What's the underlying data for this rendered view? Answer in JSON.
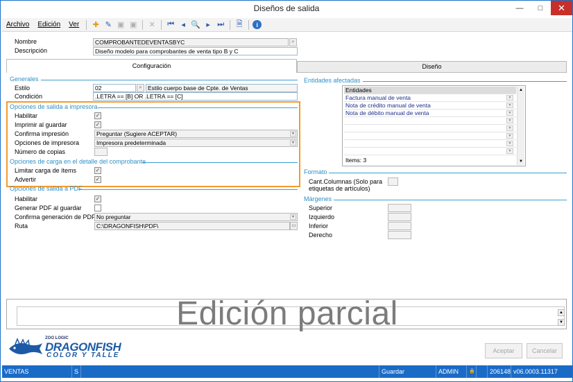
{
  "window": {
    "title": "Diseños de salida"
  },
  "menu": {
    "archivo": "Archivo",
    "edicion": "Edición",
    "ver": "Ver"
  },
  "header": {
    "nombre_label": "Nombre",
    "nombre_value": "COMPROBANTEDEVENTASBYC",
    "descripcion_label": "Descripción",
    "descripcion_value": "Diseño modelo para comprobantes de venta tipo B y C"
  },
  "tabs": {
    "configuracion": "Configuración",
    "diseno": "Diseño"
  },
  "generales": {
    "title": "Generales",
    "estilo_label": "Estilo",
    "estilo_code": "02",
    "estilo_desc": "Estilo cuerpo base de Cpte. de Ventas",
    "condicion_label": "Condición",
    "condicion_value": ".LETRA == [B] OR .LETRA == [C]"
  },
  "impresora": {
    "title": "Opciones de salida a impresora",
    "habilitar_label": "Habilitar",
    "habilitar_checked": true,
    "imprimir_label": "Imprimir al guardar",
    "imprimir_checked": true,
    "confirma_label": "Confirma impresión",
    "confirma_value": "Preguntar (Sugiere ACEPTAR)",
    "opciones_label": "Opciones de impresora",
    "opciones_value": "Impresora predeterminada",
    "copias_label": "Número de copias",
    "copias_value": ""
  },
  "carga": {
    "title": "Opciones de carga en el detalle del comprobante",
    "limitar_label": "Limitar carga de ítems",
    "limitar_checked": true,
    "advertir_label": "Advertir",
    "advertir_checked": true
  },
  "pdf": {
    "title": "Opciones de salida a PDF",
    "habilitar_label": "Habilitar",
    "habilitar_checked": true,
    "generar_label": "Generar PDF al guardar",
    "generar_checked": false,
    "confirma_label": "Confirma generación de PDF",
    "confirma_value": "No preguntar",
    "ruta_label": "Ruta",
    "ruta_value": "C:\\DRAGONFISH\\PDF\\"
  },
  "entidades": {
    "title": "Entidades afectadas",
    "header": "Entidades",
    "items": [
      "Factura manual de venta",
      "Nota de crédito manual de venta",
      "Nota de débito manual de venta"
    ],
    "count_label": "Items: 3"
  },
  "formato": {
    "title": "Formato",
    "columnas_label_1": "Cant.Columnas (Solo para",
    "columnas_label_2": "etiquetas de artículos)",
    "columnas_value": ""
  },
  "margenes": {
    "title": "Márgenes",
    "superior": "Superior",
    "izquierdo": "Izquierdo",
    "inferior": "Inferior",
    "derecho": "Derecho"
  },
  "watermark": "Edición parcial",
  "brand": {
    "small": "ZOO LOGIC",
    "main": "DRAGONFISH",
    "sub": "COLOR Y TALLE"
  },
  "buttons": {
    "aceptar": "Aceptar",
    "cancelar": "Cancelar"
  },
  "status": {
    "module": "VENTAS",
    "s": "S",
    "action": "Guardar",
    "user": "ADMIN",
    "number": "206148",
    "version": "v06.0003.11317"
  },
  "colors": {
    "accent": "#1a6bc6",
    "highlight": "#f39a2a",
    "section": "#2f8fc7"
  }
}
